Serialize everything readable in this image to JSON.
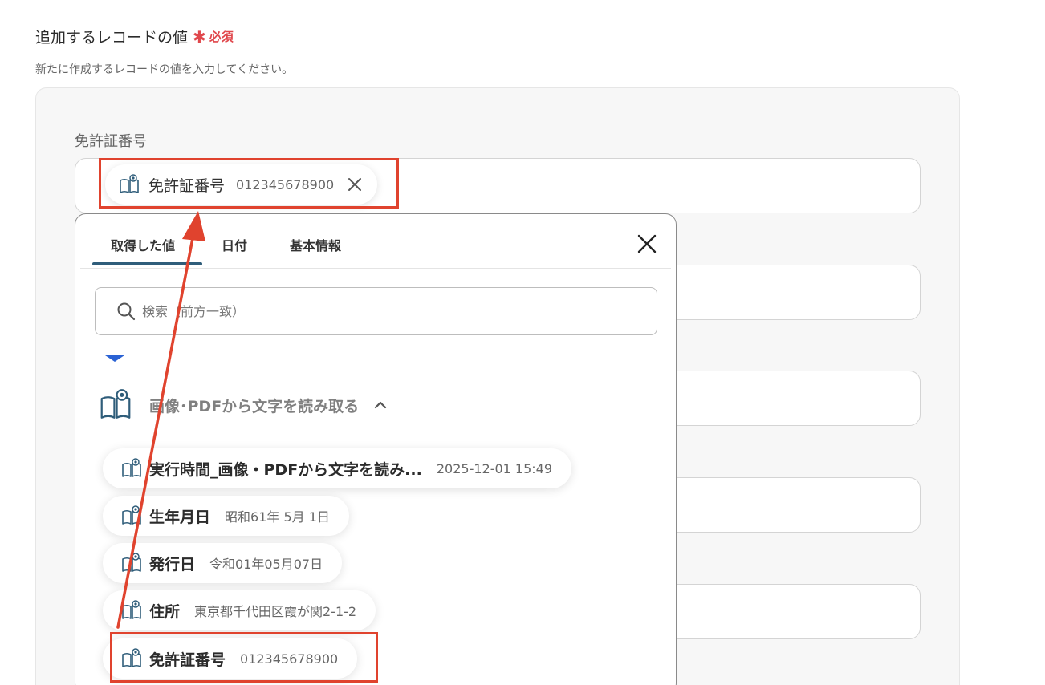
{
  "section": {
    "title": "追加するレコードの値",
    "required_mark": "✱",
    "required_label": "必須",
    "description": "新たに作成するレコードの値を入力してください。"
  },
  "field": {
    "label": "免許証番号"
  },
  "chip": {
    "label": "免許証番号",
    "value": "012345678900",
    "icon": "book-eye-icon"
  },
  "dropdown": {
    "tabs": [
      {
        "label": "取得した値",
        "active": true
      },
      {
        "label": "日付",
        "active": false
      },
      {
        "label": "基本情報",
        "active": false
      }
    ],
    "search_placeholder": "検索（前方一致）",
    "group": {
      "title": "画像･PDFから文字を読み取る",
      "icon": "book-eye-icon",
      "expanded": true
    },
    "items": [
      {
        "label": "実行時間_画像・PDFから文字を読み...",
        "value": "2025-12-01 15:49"
      },
      {
        "label": "生年月日",
        "value": "昭和61年 5月 1日"
      },
      {
        "label": "発行日",
        "value": "令和01年05月07日"
      },
      {
        "label": "住所",
        "value": "東京都千代田区霞が関2-1-2"
      },
      {
        "label": "免許証番号",
        "value": "012345678900"
      }
    ]
  },
  "colors": {
    "accent_red": "#e0432e",
    "required_red": "#e0474c",
    "tab_underline": "#2f5d7a",
    "caret_blue": "#2a62d4"
  }
}
